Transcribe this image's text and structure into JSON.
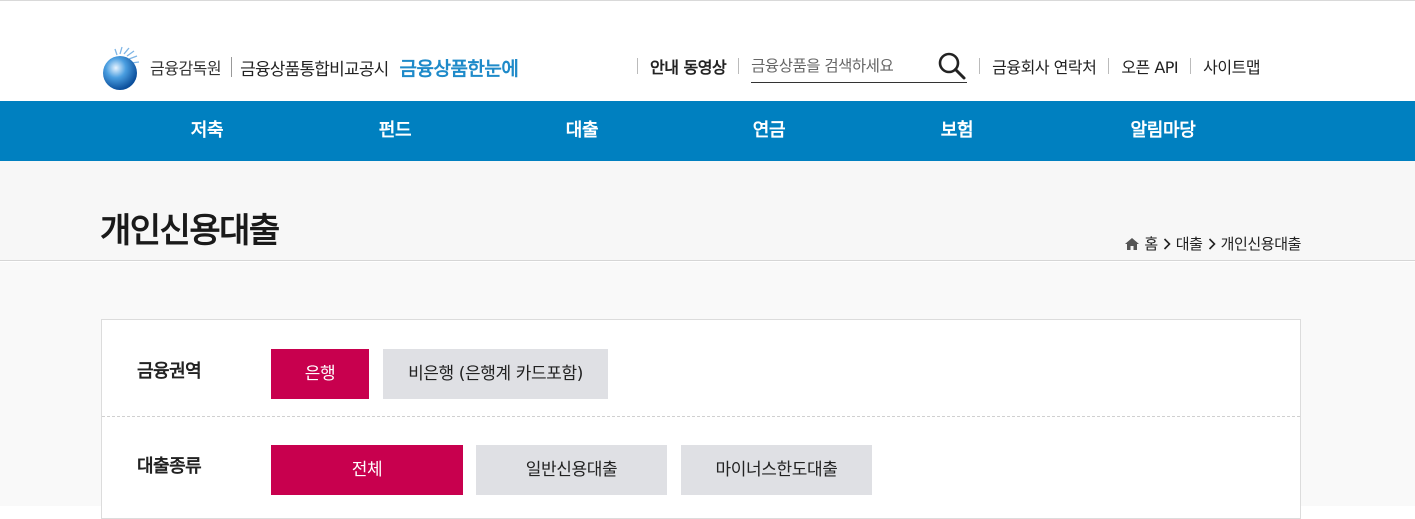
{
  "header": {
    "logo_fss": "금융감독원",
    "logo_system": "금융상품통합비교공시",
    "logo_brand": "금융상품한눈에",
    "guide_video": "안내 동영상",
    "search_placeholder": "금융상품을 검색하세요",
    "contact": "금융회사 연락처",
    "open_api": "오픈 API",
    "sitemap": "사이트맵"
  },
  "nav": {
    "items": [
      "저축",
      "펀드",
      "대출",
      "연금",
      "보험",
      "알림마당"
    ]
  },
  "page": {
    "title": "개인신용대출",
    "breadcrumb": [
      "홈",
      "대출",
      "개인신용대출"
    ]
  },
  "filters": {
    "sector": {
      "label": "금융권역",
      "options": [
        "은행",
        "비은행 (은행계 카드포함)"
      ],
      "selected": "은행"
    },
    "loan_type": {
      "label": "대출종류",
      "options": [
        "전체",
        "일반신용대출",
        "마이너스한도대출"
      ],
      "selected": "전체"
    }
  },
  "colors": {
    "nav_bg": "#0080c0",
    "active_option": "#c8004e",
    "brand_blue": "#1e8ac9"
  }
}
